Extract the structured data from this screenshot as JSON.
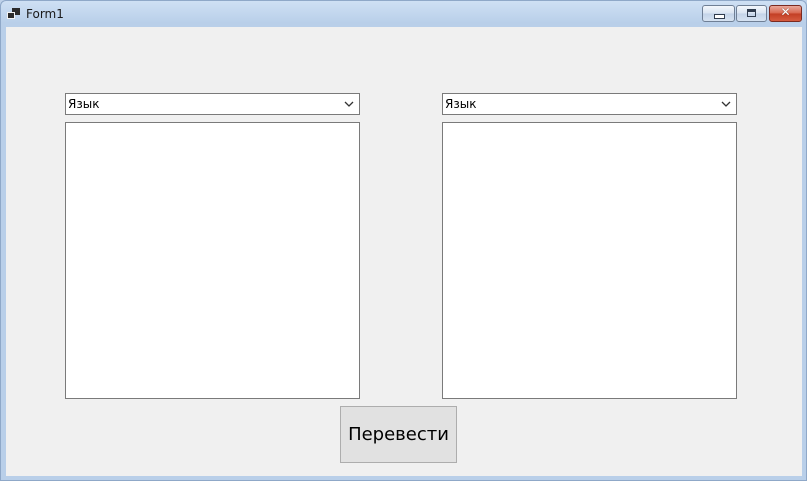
{
  "window": {
    "title": "Form1",
    "icon": "app-window-icon",
    "controls": {
      "minimize_icon": "minimize-icon",
      "maximize_icon": "maximize-icon",
      "close_icon": "close-icon",
      "close_glyph": "✕"
    },
    "accent_colors": {
      "title_bar": "#b9cfe9",
      "close_button": "#c23e24",
      "client_background": "#f0f0f0"
    }
  },
  "form": {
    "source_language": {
      "selected": "Язык",
      "arrow_icon": "chevron-down-icon"
    },
    "target_language": {
      "selected": "Язык",
      "arrow_icon": "chevron-down-icon"
    },
    "source_text": {
      "value": ""
    },
    "target_text": {
      "value": ""
    },
    "translate_label": "Перевести"
  }
}
